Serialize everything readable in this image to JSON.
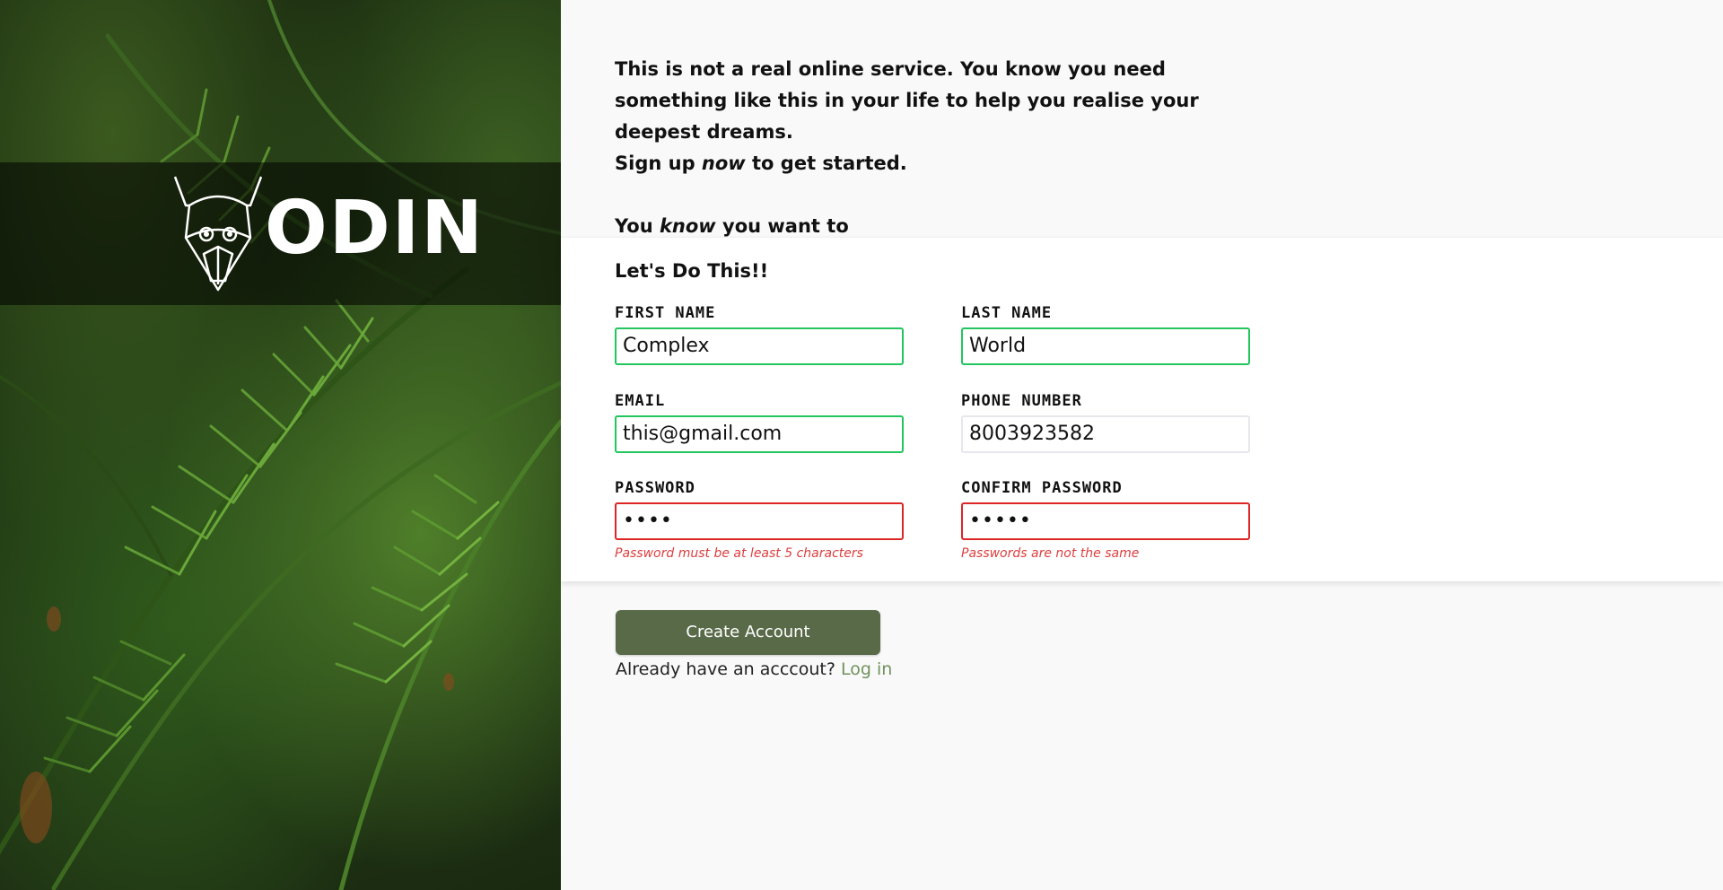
{
  "brand": {
    "name": "ODIN",
    "logo": "odin-helmet-logo"
  },
  "intro": {
    "line1": "This is not a real online service. You know you need something like this in your life to help you realise your deepest dreams.",
    "line2_pre": "Sign up ",
    "line2_em": "now",
    "line2_post": " to get started.",
    "line3_pre": "You ",
    "line3_em": "know",
    "line3_post": " you want to"
  },
  "form": {
    "title": "Let's Do This!!",
    "fields": {
      "first_name": {
        "label": "FIRST NAME",
        "value": "Complex",
        "state": "valid"
      },
      "last_name": {
        "label": "LAST NAME",
        "value": "World",
        "state": "valid"
      },
      "email": {
        "label": "EMAIL",
        "value": "this@gmail.com",
        "state": "valid"
      },
      "phone": {
        "label": "PHONE NUMBER",
        "value": "8003923582",
        "state": "neutral"
      },
      "password": {
        "label": "PASSWORD",
        "value": "••••",
        "state": "invalid",
        "error": "Password must be at least 5 characters"
      },
      "confirm_password": {
        "label": "CONFIRM PASSWORD",
        "value": "•••••",
        "state": "invalid",
        "error": "Passwords are not the same"
      }
    },
    "submit_label": "Create Account",
    "login_prompt": "Already have an acccout?",
    "login_link": "Log in"
  },
  "colors": {
    "valid": "#22c55e",
    "invalid": "#dc2626",
    "error_text": "#dc3e3e",
    "button": "#596a48",
    "link": "#71935e"
  }
}
